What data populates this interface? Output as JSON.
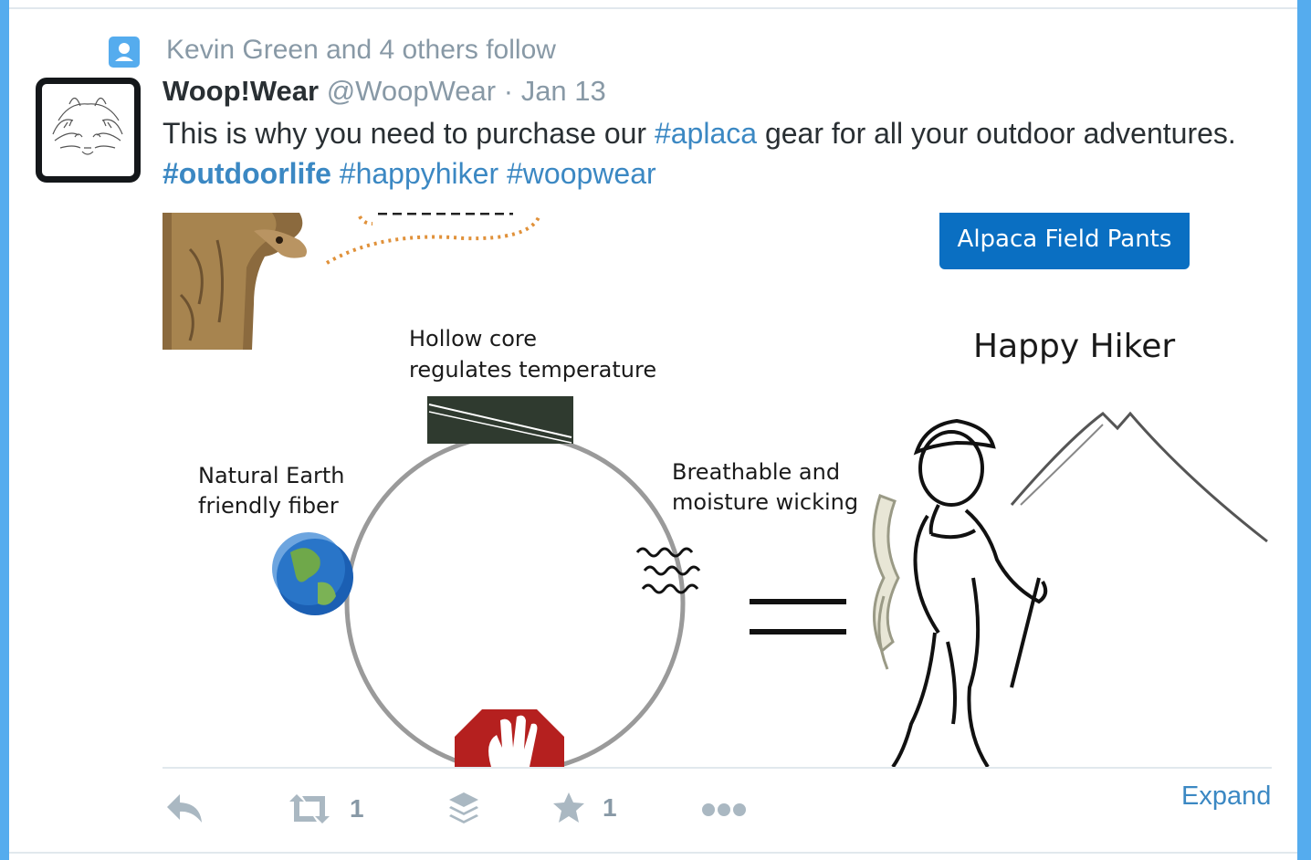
{
  "context": {
    "icon": "user-icon",
    "text": "Kevin Green and 4 others follow"
  },
  "tweet": {
    "author_name": "Woop!Wear",
    "author_handle": "@WoopWear",
    "separator": "·",
    "date": "Jan 13",
    "text_segments": {
      "intro": "This is why you need to purchase our ",
      "tag_aplaca": "#aplaca",
      "middle": " gear for all your outdoor adventures. ",
      "tag_outdoorlife": "#outdoorlife",
      "space1": " ",
      "tag_happyhiker": "#happyhiker",
      "space2": " ",
      "tag_woopwear": "#woopwear"
    }
  },
  "media": {
    "badge": "Alpaca Field Pants",
    "hollow_core_line1": "Hollow core",
    "hollow_core_line2": "regulates temperature",
    "natural_line1": "Natural Earth",
    "natural_line2": "friendly fiber",
    "breathable_line1": "Breathable and",
    "breathable_line2": "moisture wicking",
    "happy_hiker": "Happy Hiker",
    "colors": {
      "badge": "#0a6fc2",
      "circle": "#9a9a9a",
      "bubble_dots": "#e0913a"
    }
  },
  "actions": {
    "reply_icon": "reply-icon",
    "retweet_icon": "retweet-icon",
    "retweet_count": "1",
    "buffer_icon": "stack-icon",
    "favorite_icon": "star-icon",
    "favorite_count": "1",
    "more_icon": "more-dots-icon",
    "expand_label": "Expand"
  },
  "colors": {
    "accent": "#55acee",
    "link": "#3b88c3",
    "muted": "#8899a6",
    "icon_gray": "#aab8c2"
  }
}
